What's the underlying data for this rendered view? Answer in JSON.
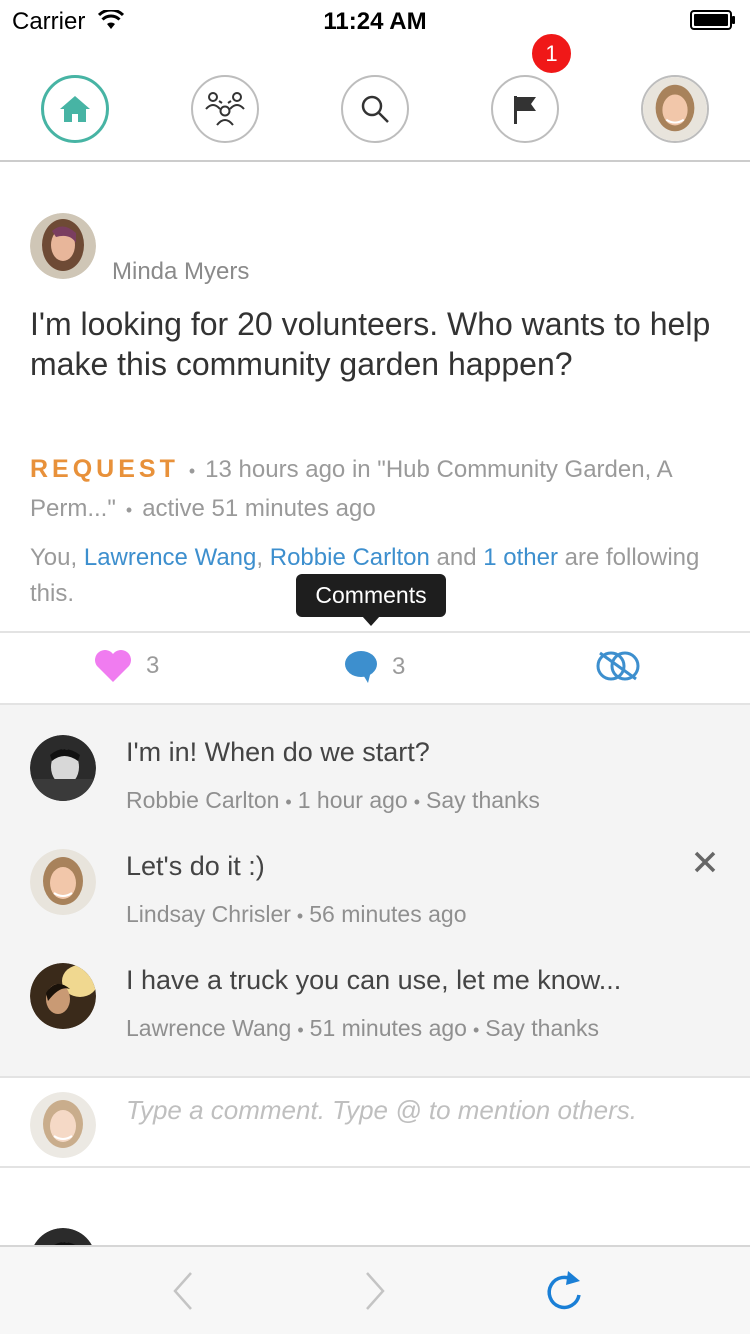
{
  "status_bar": {
    "carrier": "Carrier",
    "time": "11:24 AM"
  },
  "nav": {
    "items": [
      {
        "icon": "home-icon",
        "active": true
      },
      {
        "icon": "groups-icon",
        "active": false
      },
      {
        "icon": "search-icon",
        "active": false
      },
      {
        "icon": "flag-icon",
        "active": false
      },
      {
        "icon": "user-avatar",
        "active": false
      }
    ],
    "notification_count": "1",
    "accent_color": "#47b4a4",
    "badge_color": "#f01818"
  },
  "post": {
    "author": "Minda Myers",
    "title": "I'm looking for 20 volunteers. Who wants to help make this community garden happen?",
    "type_label": "REQUEST",
    "time": "13 hours ago in \"Hub Community Garden, A Perm...\"",
    "activity": "active 51 minutes ago",
    "following": {
      "prefix": "You,",
      "user1": "Lawrence Wang",
      "separator": ",",
      "user2": "Robbie Carlton",
      "and": "and",
      "others": "1 other",
      "suffix": "are following this."
    },
    "type_color": "#e8913a",
    "link_color": "#3d8fce"
  },
  "tooltip": {
    "label": "Comments"
  },
  "actions": {
    "likes": "3",
    "comments": "3",
    "like_color": "#f07cf0",
    "comment_color": "#3d8fce"
  },
  "comments": [
    {
      "text": "I'm in! When do we start?",
      "author": "Robbie Carlton",
      "time": "1 hour ago",
      "action": "Say thanks"
    },
    {
      "text": "Let's do it :)",
      "author": "Lindsay Chrisler",
      "time": "56 minutes ago",
      "action": ""
    },
    {
      "text": "I have a truck you can use, let me know...",
      "author": "Lawrence Wang",
      "time": "51 minutes ago",
      "action": "Say thanks"
    }
  ],
  "comment_input": {
    "placeholder": "Type a comment. Type @ to mention others."
  },
  "browser_bar": {
    "icons": [
      "back-arrow-icon",
      "forward-arrow-icon",
      "reload-icon"
    ],
    "reload_color": "#1a7fd6"
  }
}
